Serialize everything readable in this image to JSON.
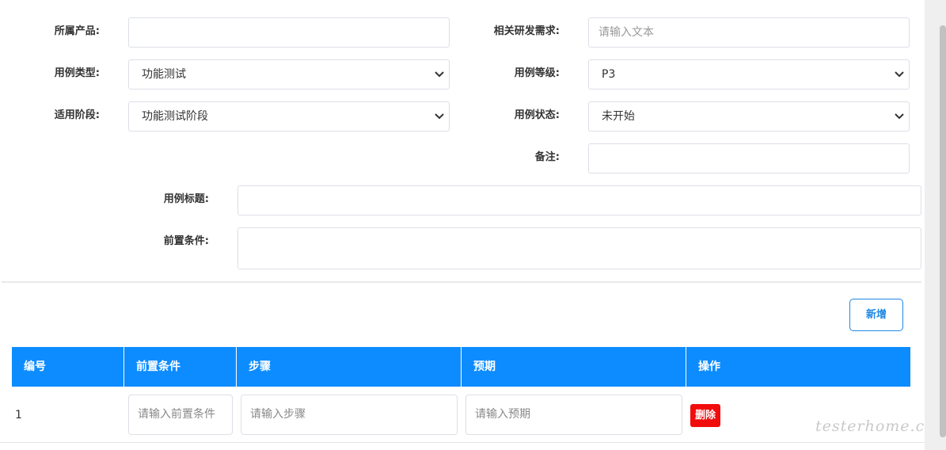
{
  "form": {
    "product": {
      "label": "所属产品:",
      "value": ""
    },
    "requirement": {
      "label": "相关研发需求:",
      "placeholder": "请输入文本"
    },
    "case_type": {
      "label": "用例类型:",
      "value": "功能测试"
    },
    "case_level": {
      "label": "用例等级:",
      "value": "P3"
    },
    "stage": {
      "label": "适用阶段:",
      "value": "功能测试阶段"
    },
    "status": {
      "label": "用例状态:",
      "value": "未开始"
    },
    "remark": {
      "label": "备注:",
      "value": ""
    },
    "title": {
      "label": "用例标题:",
      "value": ""
    },
    "precondition": {
      "label": "前置条件:",
      "value": ""
    }
  },
  "actions": {
    "add_label": "新增"
  },
  "steps_table": {
    "headers": [
      "编号",
      "前置条件",
      "步骤",
      "预期",
      "操作"
    ],
    "rows": [
      {
        "no": "1",
        "precondition_placeholder": "请输入前置条件",
        "step_placeholder": "请输入步骤",
        "expected_placeholder": "请输入预期",
        "delete_label": "删除"
      }
    ]
  },
  "watermark": "testerhome.com",
  "colors": {
    "header_blue": "#0d8cff",
    "add_button_blue": "#1e88e5",
    "delete_red": "#f20d0d"
  }
}
